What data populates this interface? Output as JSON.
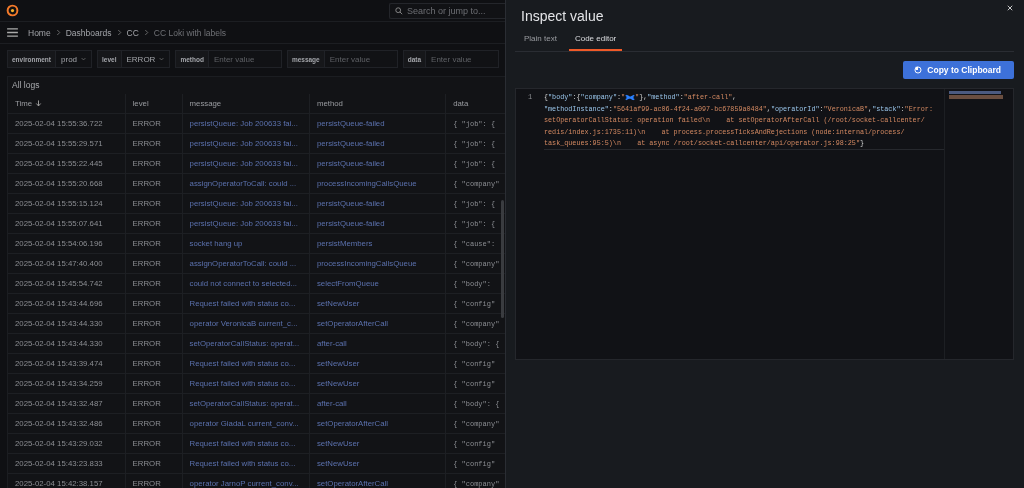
{
  "top_bar": {
    "search_placeholder": "Search or jump to..."
  },
  "breadcrumbs": [
    "Home",
    "Dashboards",
    "CC",
    "CC Loki with labels"
  ],
  "filters": [
    {
      "kind": "select",
      "label": "environment",
      "value": "prod"
    },
    {
      "kind": "select",
      "label": "level",
      "value": "ERROR"
    },
    {
      "kind": "text",
      "label": "method",
      "placeholder": "Enter value"
    },
    {
      "kind": "text",
      "label": "message",
      "placeholder": "Enter value"
    },
    {
      "kind": "text",
      "label": "data",
      "placeholder": "Enter value"
    }
  ],
  "panel": {
    "title": "All logs",
    "columns": [
      {
        "label": "Time",
        "sorted": true
      },
      {
        "label": "level",
        "sorted": false
      },
      {
        "label": "message",
        "sorted": false
      },
      {
        "label": "method",
        "sorted": false
      },
      {
        "label": "data",
        "sorted": false
      }
    ],
    "rows": [
      [
        "2025-02-04 15:55:36.722",
        "ERROR",
        "persistQueue: Job 200633 fai...",
        "persistQueue-failed",
        "{ \"job\": {"
      ],
      [
        "2025-02-04 15:55:29.571",
        "ERROR",
        "persistQueue: Job 200633 fai...",
        "persistQueue-failed",
        "{ \"job\": {"
      ],
      [
        "2025-02-04 15:55:22.445",
        "ERROR",
        "persistQueue: Job 200633 fai...",
        "persistQueue-failed",
        "{ \"job\": {"
      ],
      [
        "2025-02-04 15:55:20.668",
        "ERROR",
        "assignOperatorToCall: could ...",
        "processIncomingCallsQueue",
        "{ \"company\""
      ],
      [
        "2025-02-04 15:55:15.124",
        "ERROR",
        "persistQueue: Job 200633 fai...",
        "persistQueue-failed",
        "{ \"job\": {"
      ],
      [
        "2025-02-04 15:55:07.641",
        "ERROR",
        "persistQueue: Job 200633 fai...",
        "persistQueue-failed",
        "{ \"job\": {"
      ],
      [
        "2025-02-04 15:54:06.196",
        "ERROR",
        "socket hang up",
        "persistMembers",
        "{ \"cause\":"
      ],
      [
        "2025-02-04 15:47:40.400",
        "ERROR",
        "assignOperatorToCall: could ...",
        "processIncomingCallsQueue",
        "{ \"company\""
      ],
      [
        "2025-02-04 15:45:54.742",
        "ERROR",
        "could not connect to selected...",
        "selectFromQueue",
        "{ \"body\":"
      ],
      [
        "2025-02-04 15:43:44.696",
        "ERROR",
        "Request failed with status co...",
        "setNewUser",
        "{ \"config\""
      ],
      [
        "2025-02-04 15:43:44.330",
        "ERROR",
        "operator VeronicaB current_c...",
        "setOperatorAfterCall",
        "{ \"company\""
      ],
      [
        "2025-02-04 15:43:44.330",
        "ERROR",
        "setOperatorCallStatus: operat...",
        "after-call",
        "{ \"body\": {"
      ],
      [
        "2025-02-04 15:43:39.474",
        "ERROR",
        "Request failed with status co...",
        "setNewUser",
        "{ \"config\""
      ],
      [
        "2025-02-04 15:43:34.259",
        "ERROR",
        "Request failed with status co...",
        "setNewUser",
        "{ \"config\""
      ],
      [
        "2025-02-04 15:43:32.487",
        "ERROR",
        "setOperatorCallStatus: operat...",
        "after-call",
        "{ \"body\": {"
      ],
      [
        "2025-02-04 15:43:32.486",
        "ERROR",
        "operator GiadaL current_conv...",
        "setOperatorAfterCall",
        "{ \"company\""
      ],
      [
        "2025-02-04 15:43:29.032",
        "ERROR",
        "Request failed with status co...",
        "setNewUser",
        "{ \"config\""
      ],
      [
        "2025-02-04 15:43:23.833",
        "ERROR",
        "Request failed with status co...",
        "setNewUser",
        "{ \"config\""
      ],
      [
        "2025-02-04 15:42:38.157",
        "ERROR",
        "operator JarnoP current_conv...",
        "setOperatorAfterCall",
        "{ \"company\""
      ]
    ]
  },
  "drawer": {
    "title": "Inspect value",
    "tabs": [
      {
        "label": "Plain text",
        "selected": false
      },
      {
        "label": "Code editor",
        "selected": true
      }
    ],
    "copy_button": "Copy to Clipboard",
    "editor": {
      "line_number": "1",
      "lines": [
        [
          {
            "kind": "punct",
            "text": "{"
          },
          {
            "kind": "key",
            "text": "\"body\""
          },
          {
            "kind": "punct",
            "text": ":{"
          },
          {
            "kind": "key",
            "text": "\"company\""
          },
          {
            "kind": "punct",
            "text": ":"
          },
          {
            "kind": "string",
            "text": "\""
          },
          {
            "kind": "redacted"
          },
          {
            "kind": "string",
            "text": "\""
          },
          {
            "kind": "punct",
            "text": "},"
          },
          {
            "kind": "key",
            "text": "\"method\""
          },
          {
            "kind": "punct",
            "text": ":"
          },
          {
            "kind": "string",
            "text": "\"after-call\""
          },
          {
            "kind": "punct",
            "text": ","
          }
        ],
        [
          {
            "kind": "key",
            "text": "\"methodInstance\""
          },
          {
            "kind": "punct",
            "text": ":"
          },
          {
            "kind": "string",
            "text": "\"5641af99-ac06-4f24-a097-bc67859a0484\""
          },
          {
            "kind": "punct",
            "text": ","
          },
          {
            "kind": "key",
            "text": "\"operatorId\""
          },
          {
            "kind": "punct",
            "text": ":"
          },
          {
            "kind": "string",
            "text": "\"VeronicaB\""
          },
          {
            "kind": "punct",
            "text": ","
          },
          {
            "kind": "key",
            "text": "\"stack\""
          },
          {
            "kind": "punct",
            "text": ":"
          },
          {
            "kind": "string",
            "text": "\"Error:"
          }
        ],
        [
          {
            "kind": "string",
            "text": "setOperatorCallStatus: operation failed\\n    at setOperatorAfterCall (/root/socket-callcenter/"
          }
        ],
        [
          {
            "kind": "string",
            "text": "redis/index.js:1735:11)\\n    at process.processTicksAndRejections (node:internal/process/"
          }
        ],
        [
          {
            "kind": "string",
            "text": "task_queues:95:5)\\n    at async /root/socket-callcenter/api/operator.js:98:25\""
          },
          {
            "kind": "punct",
            "text": "}"
          }
        ]
      ]
    }
  }
}
